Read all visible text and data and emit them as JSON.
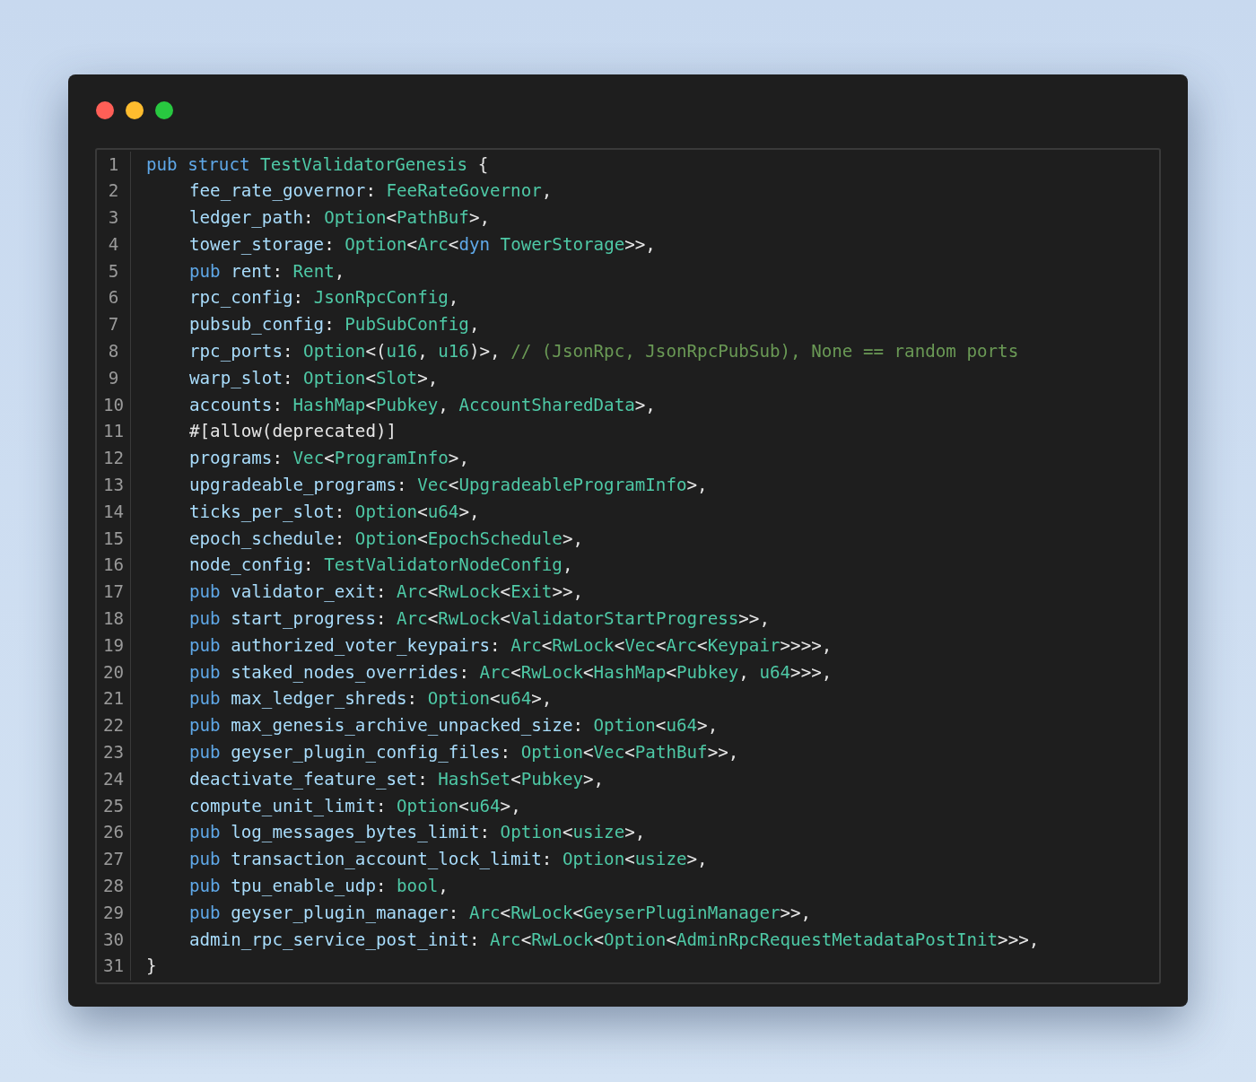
{
  "window": {
    "controls": [
      {
        "color": "#ff5f57"
      },
      {
        "color": "#febc2e"
      },
      {
        "color": "#28c840"
      }
    ]
  },
  "code": {
    "lines": [
      {
        "number": "1",
        "indented": false,
        "tokens": [
          {
            "kind": "keyword",
            "text": "pub struct "
          },
          {
            "kind": "type",
            "text": "TestValidatorGenesis"
          },
          {
            "kind": "punct",
            "text": " {"
          }
        ]
      },
      {
        "number": "2",
        "indented": true,
        "tokens": [
          {
            "kind": "field",
            "text": "fee_rate_governor"
          },
          {
            "kind": "punct",
            "text": ": "
          },
          {
            "kind": "type",
            "text": "FeeRateGovernor"
          },
          {
            "kind": "punct",
            "text": ","
          }
        ]
      },
      {
        "number": "3",
        "indented": true,
        "tokens": [
          {
            "kind": "field",
            "text": "ledger_path"
          },
          {
            "kind": "punct",
            "text": ": "
          },
          {
            "kind": "type",
            "text": "Option"
          },
          {
            "kind": "punct",
            "text": "<"
          },
          {
            "kind": "type",
            "text": "PathBuf"
          },
          {
            "kind": "punct",
            "text": ">,"
          }
        ]
      },
      {
        "number": "4",
        "indented": true,
        "tokens": [
          {
            "kind": "field",
            "text": "tower_storage"
          },
          {
            "kind": "punct",
            "text": ": "
          },
          {
            "kind": "type",
            "text": "Option"
          },
          {
            "kind": "punct",
            "text": "<"
          },
          {
            "kind": "type",
            "text": "Arc"
          },
          {
            "kind": "punct",
            "text": "<"
          },
          {
            "kind": "keyword",
            "text": "dyn "
          },
          {
            "kind": "type",
            "text": "TowerStorage"
          },
          {
            "kind": "punct",
            "text": ">>,"
          }
        ]
      },
      {
        "number": "5",
        "indented": true,
        "tokens": [
          {
            "kind": "keyword",
            "text": "pub "
          },
          {
            "kind": "field",
            "text": "rent"
          },
          {
            "kind": "punct",
            "text": ": "
          },
          {
            "kind": "type",
            "text": "Rent"
          },
          {
            "kind": "punct",
            "text": ","
          }
        ]
      },
      {
        "number": "6",
        "indented": true,
        "tokens": [
          {
            "kind": "field",
            "text": "rpc_config"
          },
          {
            "kind": "punct",
            "text": ": "
          },
          {
            "kind": "type",
            "text": "JsonRpcConfig"
          },
          {
            "kind": "punct",
            "text": ","
          }
        ]
      },
      {
        "number": "7",
        "indented": true,
        "tokens": [
          {
            "kind": "field",
            "text": "pubsub_config"
          },
          {
            "kind": "punct",
            "text": ": "
          },
          {
            "kind": "type",
            "text": "PubSubConfig"
          },
          {
            "kind": "punct",
            "text": ","
          }
        ]
      },
      {
        "number": "8",
        "indented": true,
        "tokens": [
          {
            "kind": "field",
            "text": "rpc_ports"
          },
          {
            "kind": "punct",
            "text": ": "
          },
          {
            "kind": "type",
            "text": "Option"
          },
          {
            "kind": "punct",
            "text": "<("
          },
          {
            "kind": "type",
            "text": "u16"
          },
          {
            "kind": "punct",
            "text": ", "
          },
          {
            "kind": "type",
            "text": "u16"
          },
          {
            "kind": "punct",
            "text": ")>, "
          },
          {
            "kind": "comment",
            "text": "// (JsonRpc, JsonRpcPubSub), None == random ports"
          }
        ]
      },
      {
        "number": "9",
        "indented": true,
        "tokens": [
          {
            "kind": "field",
            "text": "warp_slot"
          },
          {
            "kind": "punct",
            "text": ": "
          },
          {
            "kind": "type",
            "text": "Option"
          },
          {
            "kind": "punct",
            "text": "<"
          },
          {
            "kind": "type",
            "text": "Slot"
          },
          {
            "kind": "punct",
            "text": ">,"
          }
        ]
      },
      {
        "number": "10",
        "indented": true,
        "tokens": [
          {
            "kind": "field",
            "text": "accounts"
          },
          {
            "kind": "punct",
            "text": ": "
          },
          {
            "kind": "type",
            "text": "HashMap"
          },
          {
            "kind": "punct",
            "text": "<"
          },
          {
            "kind": "type",
            "text": "Pubkey"
          },
          {
            "kind": "punct",
            "text": ", "
          },
          {
            "kind": "type",
            "text": "AccountSharedData"
          },
          {
            "kind": "punct",
            "text": ">,"
          }
        ]
      },
      {
        "number": "11",
        "indented": true,
        "tokens": [
          {
            "kind": "punct",
            "text": "#[allow(deprecated)]"
          }
        ]
      },
      {
        "number": "12",
        "indented": true,
        "tokens": [
          {
            "kind": "field",
            "text": "programs"
          },
          {
            "kind": "punct",
            "text": ": "
          },
          {
            "kind": "type",
            "text": "Vec"
          },
          {
            "kind": "punct",
            "text": "<"
          },
          {
            "kind": "type",
            "text": "ProgramInfo"
          },
          {
            "kind": "punct",
            "text": ">,"
          }
        ]
      },
      {
        "number": "13",
        "indented": true,
        "tokens": [
          {
            "kind": "field",
            "text": "upgradeable_programs"
          },
          {
            "kind": "punct",
            "text": ": "
          },
          {
            "kind": "type",
            "text": "Vec"
          },
          {
            "kind": "punct",
            "text": "<"
          },
          {
            "kind": "type",
            "text": "UpgradeableProgramInfo"
          },
          {
            "kind": "punct",
            "text": ">,"
          }
        ]
      },
      {
        "number": "14",
        "indented": true,
        "tokens": [
          {
            "kind": "field",
            "text": "ticks_per_slot"
          },
          {
            "kind": "punct",
            "text": ": "
          },
          {
            "kind": "type",
            "text": "Option"
          },
          {
            "kind": "punct",
            "text": "<"
          },
          {
            "kind": "type",
            "text": "u64"
          },
          {
            "kind": "punct",
            "text": ">,"
          }
        ]
      },
      {
        "number": "15",
        "indented": true,
        "tokens": [
          {
            "kind": "field",
            "text": "epoch_schedule"
          },
          {
            "kind": "punct",
            "text": ": "
          },
          {
            "kind": "type",
            "text": "Option"
          },
          {
            "kind": "punct",
            "text": "<"
          },
          {
            "kind": "type",
            "text": "EpochSchedule"
          },
          {
            "kind": "punct",
            "text": ">,"
          }
        ]
      },
      {
        "number": "16",
        "indented": true,
        "tokens": [
          {
            "kind": "field",
            "text": "node_config"
          },
          {
            "kind": "punct",
            "text": ": "
          },
          {
            "kind": "type",
            "text": "TestValidatorNodeConfig"
          },
          {
            "kind": "punct",
            "text": ","
          }
        ]
      },
      {
        "number": "17",
        "indented": true,
        "tokens": [
          {
            "kind": "keyword",
            "text": "pub "
          },
          {
            "kind": "field",
            "text": "validator_exit"
          },
          {
            "kind": "punct",
            "text": ": "
          },
          {
            "kind": "type",
            "text": "Arc"
          },
          {
            "kind": "punct",
            "text": "<"
          },
          {
            "kind": "type",
            "text": "RwLock"
          },
          {
            "kind": "punct",
            "text": "<"
          },
          {
            "kind": "type",
            "text": "Exit"
          },
          {
            "kind": "punct",
            "text": ">>,"
          }
        ]
      },
      {
        "number": "18",
        "indented": true,
        "tokens": [
          {
            "kind": "keyword",
            "text": "pub "
          },
          {
            "kind": "field",
            "text": "start_progress"
          },
          {
            "kind": "punct",
            "text": ": "
          },
          {
            "kind": "type",
            "text": "Arc"
          },
          {
            "kind": "punct",
            "text": "<"
          },
          {
            "kind": "type",
            "text": "RwLock"
          },
          {
            "kind": "punct",
            "text": "<"
          },
          {
            "kind": "type",
            "text": "ValidatorStartProgress"
          },
          {
            "kind": "punct",
            "text": ">>,"
          }
        ]
      },
      {
        "number": "19",
        "indented": true,
        "tokens": [
          {
            "kind": "keyword",
            "text": "pub "
          },
          {
            "kind": "field",
            "text": "authorized_voter_keypairs"
          },
          {
            "kind": "punct",
            "text": ": "
          },
          {
            "kind": "type",
            "text": "Arc"
          },
          {
            "kind": "punct",
            "text": "<"
          },
          {
            "kind": "type",
            "text": "RwLock"
          },
          {
            "kind": "punct",
            "text": "<"
          },
          {
            "kind": "type",
            "text": "Vec"
          },
          {
            "kind": "punct",
            "text": "<"
          },
          {
            "kind": "type",
            "text": "Arc"
          },
          {
            "kind": "punct",
            "text": "<"
          },
          {
            "kind": "type",
            "text": "Keypair"
          },
          {
            "kind": "punct",
            "text": ">>>>,"
          }
        ]
      },
      {
        "number": "20",
        "indented": true,
        "tokens": [
          {
            "kind": "keyword",
            "text": "pub "
          },
          {
            "kind": "field",
            "text": "staked_nodes_overrides"
          },
          {
            "kind": "punct",
            "text": ": "
          },
          {
            "kind": "type",
            "text": "Arc"
          },
          {
            "kind": "punct",
            "text": "<"
          },
          {
            "kind": "type",
            "text": "RwLock"
          },
          {
            "kind": "punct",
            "text": "<"
          },
          {
            "kind": "type",
            "text": "HashMap"
          },
          {
            "kind": "punct",
            "text": "<"
          },
          {
            "kind": "type",
            "text": "Pubkey"
          },
          {
            "kind": "punct",
            "text": ", "
          },
          {
            "kind": "type",
            "text": "u64"
          },
          {
            "kind": "punct",
            "text": ">>>,"
          }
        ]
      },
      {
        "number": "21",
        "indented": true,
        "tokens": [
          {
            "kind": "keyword",
            "text": "pub "
          },
          {
            "kind": "field",
            "text": "max_ledger_shreds"
          },
          {
            "kind": "punct",
            "text": ": "
          },
          {
            "kind": "type",
            "text": "Option"
          },
          {
            "kind": "punct",
            "text": "<"
          },
          {
            "kind": "type",
            "text": "u64"
          },
          {
            "kind": "punct",
            "text": ">,"
          }
        ]
      },
      {
        "number": "22",
        "indented": true,
        "tokens": [
          {
            "kind": "keyword",
            "text": "pub "
          },
          {
            "kind": "field",
            "text": "max_genesis_archive_unpacked_size"
          },
          {
            "kind": "punct",
            "text": ": "
          },
          {
            "kind": "type",
            "text": "Option"
          },
          {
            "kind": "punct",
            "text": "<"
          },
          {
            "kind": "type",
            "text": "u64"
          },
          {
            "kind": "punct",
            "text": ">,"
          }
        ]
      },
      {
        "number": "23",
        "indented": true,
        "tokens": [
          {
            "kind": "keyword",
            "text": "pub "
          },
          {
            "kind": "field",
            "text": "geyser_plugin_config_files"
          },
          {
            "kind": "punct",
            "text": ": "
          },
          {
            "kind": "type",
            "text": "Option"
          },
          {
            "kind": "punct",
            "text": "<"
          },
          {
            "kind": "type",
            "text": "Vec"
          },
          {
            "kind": "punct",
            "text": "<"
          },
          {
            "kind": "type",
            "text": "PathBuf"
          },
          {
            "kind": "punct",
            "text": ">>,"
          }
        ]
      },
      {
        "number": "24",
        "indented": true,
        "tokens": [
          {
            "kind": "field",
            "text": "deactivate_feature_set"
          },
          {
            "kind": "punct",
            "text": ": "
          },
          {
            "kind": "type",
            "text": "HashSet"
          },
          {
            "kind": "punct",
            "text": "<"
          },
          {
            "kind": "type",
            "text": "Pubkey"
          },
          {
            "kind": "punct",
            "text": ">,"
          }
        ]
      },
      {
        "number": "25",
        "indented": true,
        "tokens": [
          {
            "kind": "field",
            "text": "compute_unit_limit"
          },
          {
            "kind": "punct",
            "text": ": "
          },
          {
            "kind": "type",
            "text": "Option"
          },
          {
            "kind": "punct",
            "text": "<"
          },
          {
            "kind": "type",
            "text": "u64"
          },
          {
            "kind": "punct",
            "text": ">,"
          }
        ]
      },
      {
        "number": "26",
        "indented": true,
        "tokens": [
          {
            "kind": "keyword",
            "text": "pub "
          },
          {
            "kind": "field",
            "text": "log_messages_bytes_limit"
          },
          {
            "kind": "punct",
            "text": ": "
          },
          {
            "kind": "type",
            "text": "Option"
          },
          {
            "kind": "punct",
            "text": "<"
          },
          {
            "kind": "type",
            "text": "usize"
          },
          {
            "kind": "punct",
            "text": ">,"
          }
        ]
      },
      {
        "number": "27",
        "indented": true,
        "tokens": [
          {
            "kind": "keyword",
            "text": "pub "
          },
          {
            "kind": "field",
            "text": "transaction_account_lock_limit"
          },
          {
            "kind": "punct",
            "text": ": "
          },
          {
            "kind": "type",
            "text": "Option"
          },
          {
            "kind": "punct",
            "text": "<"
          },
          {
            "kind": "type",
            "text": "usize"
          },
          {
            "kind": "punct",
            "text": ">,"
          }
        ]
      },
      {
        "number": "28",
        "indented": true,
        "tokens": [
          {
            "kind": "keyword",
            "text": "pub "
          },
          {
            "kind": "field",
            "text": "tpu_enable_udp"
          },
          {
            "kind": "punct",
            "text": ": "
          },
          {
            "kind": "type",
            "text": "bool"
          },
          {
            "kind": "punct",
            "text": ","
          }
        ]
      },
      {
        "number": "29",
        "indented": true,
        "tokens": [
          {
            "kind": "keyword",
            "text": "pub "
          },
          {
            "kind": "field",
            "text": "geyser_plugin_manager"
          },
          {
            "kind": "punct",
            "text": ": "
          },
          {
            "kind": "type",
            "text": "Arc"
          },
          {
            "kind": "punct",
            "text": "<"
          },
          {
            "kind": "type",
            "text": "RwLock"
          },
          {
            "kind": "punct",
            "text": "<"
          },
          {
            "kind": "type",
            "text": "GeyserPluginManager"
          },
          {
            "kind": "punct",
            "text": ">>,"
          }
        ]
      },
      {
        "number": "30",
        "indented": true,
        "tokens": [
          {
            "kind": "field",
            "text": "admin_rpc_service_post_init"
          },
          {
            "kind": "punct",
            "text": ": "
          },
          {
            "kind": "type",
            "text": "Arc"
          },
          {
            "kind": "punct",
            "text": "<"
          },
          {
            "kind": "type",
            "text": "RwLock"
          },
          {
            "kind": "punct",
            "text": "<"
          },
          {
            "kind": "type",
            "text": "Option"
          },
          {
            "kind": "punct",
            "text": "<"
          },
          {
            "kind": "type",
            "text": "AdminRpcRequestMetadataPostInit"
          },
          {
            "kind": "punct",
            "text": ">>>,"
          }
        ]
      },
      {
        "number": "31",
        "indented": false,
        "tokens": [
          {
            "kind": "punct",
            "text": "}"
          }
        ]
      }
    ]
  }
}
